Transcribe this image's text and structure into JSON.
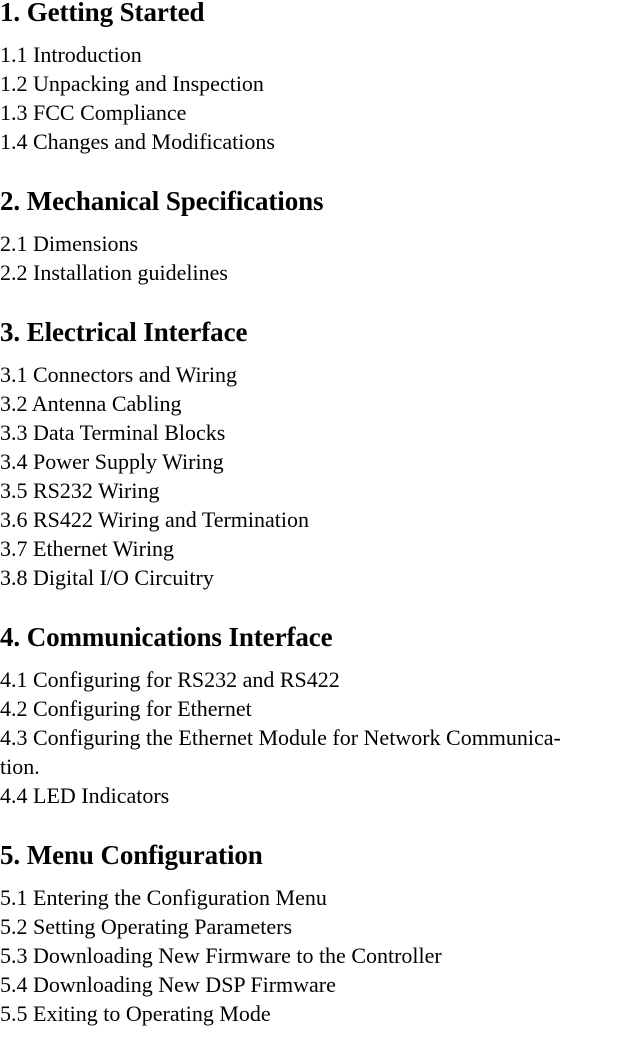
{
  "document": {
    "type": "table-of-contents",
    "background_color": "#ffffff",
    "text_color": "#000000"
  },
  "sections": [
    {
      "heading": "1. Getting Started",
      "entries": [
        "1.1 Introduction",
        "1.2 Unpacking and Inspection",
        "1.3 FCC Compliance",
        "1.4 Changes and Modifications"
      ]
    },
    {
      "heading": "2. Mechanical Specifications",
      "entries": [
        "2.1 Dimensions",
        "2.2 Installation guidelines"
      ]
    },
    {
      "heading": "3. Electrical Interface",
      "entries": [
        "3.1 Connectors and Wiring",
        "3.2 Antenna Cabling",
        "3.3 Data Terminal Blocks",
        "3.4 Power Supply Wiring",
        "3.5 RS232 Wiring",
        "3.6 RS422 Wiring and Termination",
        "3.7 Ethernet Wiring",
        "3.8 Digital I/O Circuitry"
      ]
    },
    {
      "heading": "4. Communications Interface",
      "entries": [
        "4.1 Configuring for RS232 and RS422",
        "4.2 Configuring for Ethernet",
        "4.3 Configuring the Ethernet Module for Network Communica-\ntion.",
        "4.4 LED Indicators"
      ]
    },
    {
      "heading": "5. Menu Configuration",
      "entries": [
        "5.1 Entering the Configuration Menu",
        "5.2 Setting Operating Parameters",
        "5.3 Downloading New Firmware to the Controller",
        "5.4 Downloading New DSP Firmware",
        "5.5 Exiting to Operating Mode"
      ]
    }
  ]
}
